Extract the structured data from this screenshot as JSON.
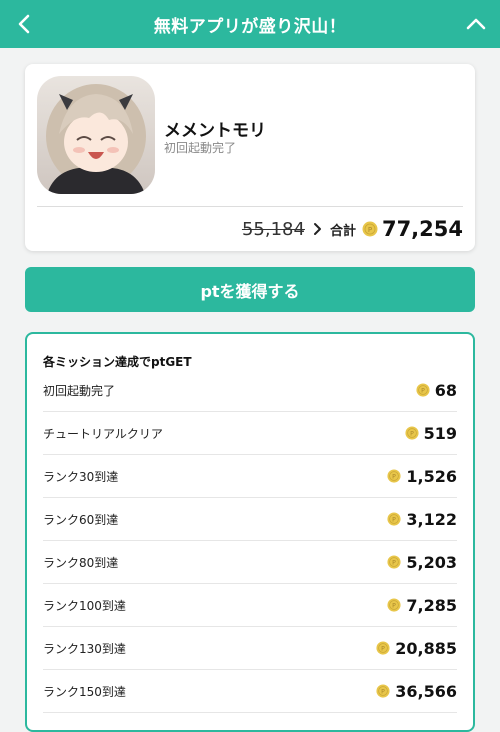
{
  "header": {
    "title": "無料アプリが盛り沢山！",
    "theme_color": "#2cb89e"
  },
  "app": {
    "name": "メメントモリ",
    "status": "初回起動完了",
    "old_points": "55,184",
    "total_label": "合計",
    "total_points": "77,254"
  },
  "cta": {
    "label": "ptを獲得する"
  },
  "missions": {
    "title": "各ミッション達成でptGET",
    "items": [
      {
        "label": "初回起動完了",
        "points": "68"
      },
      {
        "label": "チュートリアルクリア",
        "points": "519"
      },
      {
        "label": "ランク30到達",
        "points": "1,526"
      },
      {
        "label": "ランク60到達",
        "points": "3,122"
      },
      {
        "label": "ランク80到達",
        "points": "5,203"
      },
      {
        "label": "ランク100到達",
        "points": "7,285"
      },
      {
        "label": "ランク130到達",
        "points": "20,885"
      },
      {
        "label": "ランク150到達",
        "points": "36,566"
      }
    ]
  },
  "icons": {
    "back": "chevron-left-icon",
    "collapse": "chevron-up-icon",
    "coin": "point-coin-icon",
    "arrow": "chevron-right-icon"
  },
  "coin_color": "#e8c64a"
}
